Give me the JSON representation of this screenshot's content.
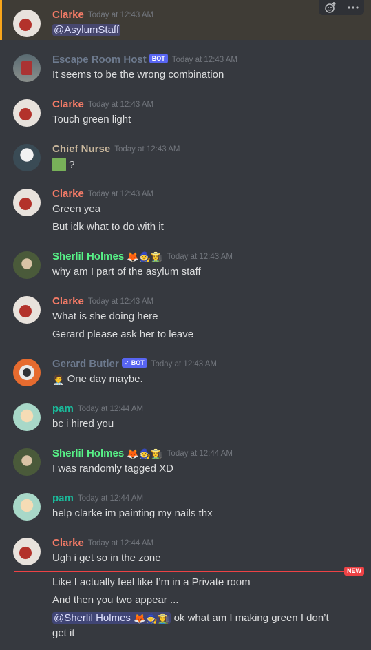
{
  "toolbar": {
    "react_icon": "add-reaction-icon",
    "more_icon": "more-icon"
  },
  "new_label": "NEW",
  "messages": [
    {
      "author": "Clarke",
      "color": "#f47b67",
      "ts": "Today at 12:43 AM",
      "lines": [
        "@AsylumStaff"
      ],
      "avatar": "clarke"
    },
    {
      "author": "Escape Room Host",
      "color": "#6d7a8e",
      "bot": "BOT",
      "ts": "Today at 12:43 AM",
      "lines": [
        "It seems to be the wrong combination"
      ],
      "avatar": "host"
    },
    {
      "author": "Clarke",
      "color": "#f47b67",
      "ts": "Today at 12:43 AM",
      "lines": [
        "Touch green light"
      ]
    },
    {
      "author": "Chief Nurse",
      "color": "#c9b79c",
      "ts": "Today at 12:43 AM",
      "lines": [
        "?"
      ]
    },
    {
      "author": "Clarke",
      "color": "#f47b67",
      "ts": "Today at 12:43 AM",
      "lines": [
        "Green yea",
        "But idk what to do with it"
      ]
    },
    {
      "author": "Sherlil Holmes",
      "color": "#57f287",
      "emoji": "🦊🧙👩‍🌾",
      "ts": "Today at 12:43 AM",
      "lines": [
        "why am I part of the asylum staff"
      ]
    },
    {
      "author": "Clarke",
      "color": "#f47b67",
      "ts": "Today at 12:43 AM",
      "lines": [
        "What is she doing here",
        "Gerard please ask her to leave"
      ]
    },
    {
      "author": "Gerard Butler",
      "color": "#6d7a8e",
      "bot": "✓ BOT",
      "ts": "Today at 12:43 AM",
      "lines": [
        "One day maybe."
      ]
    },
    {
      "author": "pam",
      "color": "#1abc9c",
      "ts": "Today at 12:44 AM",
      "lines": [
        "bc i hired you"
      ]
    },
    {
      "author": "Sherlil Holmes",
      "color": "#57f287",
      "emoji": "🦊🧙👩‍🌾",
      "ts": "Today at 12:44 AM",
      "lines": [
        "I was randomly tagged XD"
      ]
    },
    {
      "author": "pam",
      "color": "#1abc9c",
      "ts": "Today at 12:44 AM",
      "lines": [
        "help clarke im painting my nails thx"
      ]
    },
    {
      "author": "Clarke",
      "color": "#f47b67",
      "ts": "Today at 12:44 AM",
      "lines": [
        "Ugh i get so in the zone",
        "Like I actually feel like I’m in a Private room",
        "And then you two appear ...",
        "ok what am I making green I don’t",
        "get it"
      ]
    }
  ],
  "mention_last": "@Sherlil Holmes",
  "mention_emoji": "🦊🧙👩‍🌾",
  "nurse_emoji": "🟩",
  "gerard_emoji": "🧑‍⚕️"
}
